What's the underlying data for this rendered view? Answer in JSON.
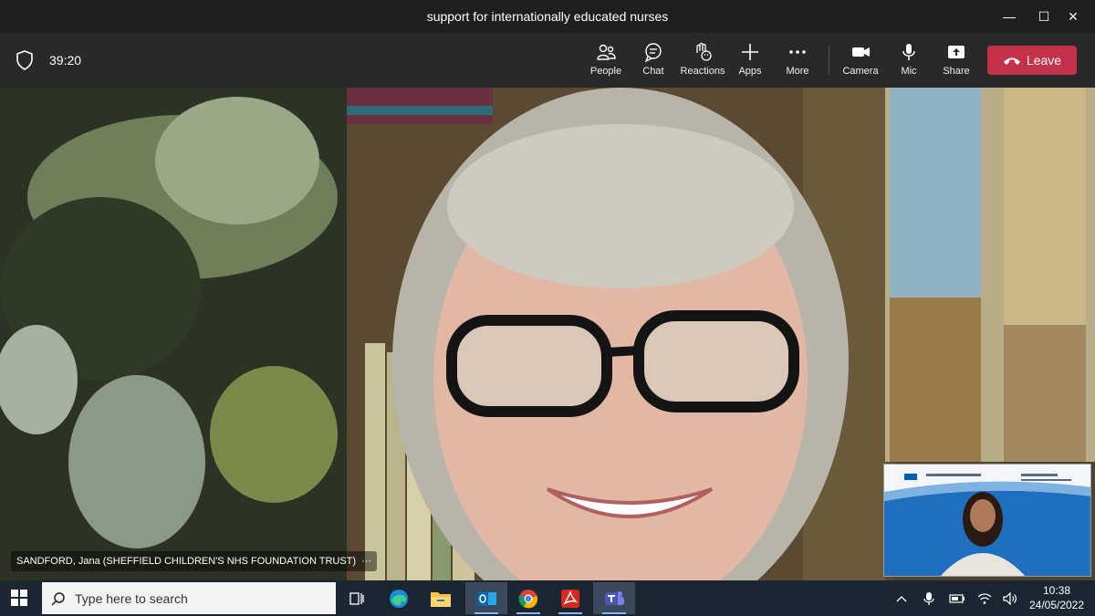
{
  "window": {
    "title": "support for internationally educated nurses",
    "minimize_glyph": "—",
    "maximize_glyph": "☐",
    "close_glyph": "✕"
  },
  "meeting": {
    "timer": "39:20",
    "controls": [
      {
        "id": "people",
        "label": "People",
        "icon": "people-icon"
      },
      {
        "id": "chat",
        "label": "Chat",
        "icon": "chat-icon"
      },
      {
        "id": "reactions",
        "label": "Reactions",
        "icon": "reactions-icon"
      },
      {
        "id": "apps",
        "label": "Apps",
        "icon": "plus-icon"
      },
      {
        "id": "more",
        "label": "More",
        "icon": "more-icon"
      },
      {
        "id": "camera",
        "label": "Camera",
        "icon": "camera-icon"
      },
      {
        "id": "mic",
        "label": "Mic",
        "icon": "mic-icon"
      },
      {
        "id": "share",
        "label": "Share",
        "icon": "share-icon"
      }
    ],
    "leave_label": "Leave",
    "leave_color": "#c4314b"
  },
  "video": {
    "main_participant": "SANDFORD, Jana (SHEFFIELD CHILDREN'S NHS FOUNDATION TRUST)",
    "more_glyph": "···"
  },
  "taskbar": {
    "search_placeholder": "Type here to search",
    "apps": [
      "task-view-icon",
      "edge-icon",
      "file-explorer-icon",
      "outlook-icon",
      "chrome-icon",
      "acrobat-icon",
      "teams-icon"
    ],
    "time": "10:38",
    "date": "24/05/2022"
  }
}
